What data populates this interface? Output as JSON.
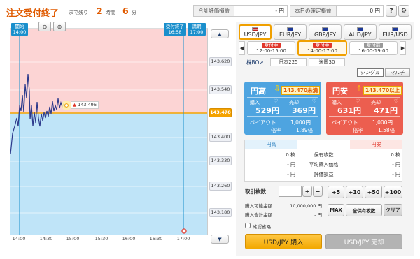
{
  "header": {
    "title": "注文受付終了",
    "remaining_prefix": "まで残り",
    "hours_value": "2",
    "hours_unit": "時間",
    "minutes_value": "6",
    "minutes_unit": "分",
    "total_eval_label": "合計評価損益",
    "total_eval_value": "- 円",
    "settled_label": "本日の確定損益",
    "settled_value": "0 円",
    "help_icon": "question-icon",
    "settings_icon": "gear-icon"
  },
  "chart": {
    "open_tag": [
      "開始",
      "14:00"
    ],
    "close_tag": [
      "受付終了",
      "16:58"
    ],
    "expiry_tag": [
      "満期",
      "17:00"
    ],
    "current_price_label": "143.496",
    "y_ticks": [
      "143.620",
      "143.540",
      "143.470",
      "143.400",
      "143.330",
      "143.260",
      "143.180"
    ],
    "current_y_tick": "143.470",
    "x_ticks": [
      "14:00",
      "14:30",
      "15:00",
      "15:30",
      "16:00",
      "16:30",
      "17:00"
    ],
    "zoom_out_icon": "zoom-out-icon",
    "zoom_in_icon": "zoom-in-icon",
    "scroll_up": "▲",
    "scroll_down": "▼",
    "colors": {
      "upper_zone": "#fcd4d4",
      "lower_zone": "#bfe4f8",
      "line": "#2d3a8c",
      "target": "#f5a300"
    }
  },
  "currency_tabs": [
    {
      "label": "USD/JPY",
      "selected": true
    },
    {
      "label": "EUR/JPY",
      "selected": false
    },
    {
      "label": "GBP/JPY",
      "selected": false
    },
    {
      "label": "AUD/JPY",
      "selected": false
    },
    {
      "label": "EUR/USD",
      "selected": false
    }
  ],
  "sessions": [
    {
      "status": "受付中",
      "time": "12:00-15:00",
      "selected": false,
      "status_color": "#e0362a"
    },
    {
      "status": "受付中",
      "time": "14:00-17:00",
      "selected": true,
      "status_color": "#e0362a"
    },
    {
      "status": "受付前",
      "time": "16:00-19:00",
      "selected": false,
      "status_color": "#999999"
    }
  ],
  "markets": {
    "link": "株BO↗",
    "nikkei": "日本225",
    "us": "米国30"
  },
  "modes": {
    "single": "シングル",
    "multi": "マルチ"
  },
  "high_card": {
    "title": "円高",
    "target": "143.470未満",
    "buy_label": "購入",
    "sell_label": "売却",
    "buy_price": "529円",
    "sell_price": "369円",
    "payout_label": "ペイアウト",
    "payout_value": "1,000円",
    "rate_label": "倍率",
    "rate_value": "1.89倍",
    "color": "#4ea4e0"
  },
  "low_card": {
    "title": "円安",
    "target": "143.470以上",
    "buy_label": "購入",
    "sell_label": "売却",
    "buy_price": "631円",
    "sell_price": "471円",
    "payout_label": "ペイアウト",
    "payout_value": "1,000円",
    "rate_label": "倍率",
    "rate_value": "1.58倍",
    "color": "#ec5e4f"
  },
  "holdings": {
    "high_header": "円高",
    "low_header": "円安",
    "rows": [
      {
        "left": "0 枚",
        "label": "保有枚数",
        "right": "0 枚"
      },
      {
        "left": "- 円",
        "label": "平均購入価格",
        "right": "- 円"
      },
      {
        "left": "- 円",
        "label": "評価損益",
        "right": "- 円"
      }
    ]
  },
  "order": {
    "qty_label": "取引枚数",
    "qty_value": "",
    "plus": "+",
    "minus": "−",
    "available_label": "購入可能金額",
    "available_value": "10,000,000 円",
    "total_label": "購入合計金額",
    "total_value": "- 円",
    "quick": [
      "+5",
      "+10",
      "+50",
      "+100"
    ],
    "max": "MAX",
    "all_holdings": "全保有枚数",
    "clear": "クリア",
    "confirm_skip": "確認省略",
    "buy_button": "USD/JPY 購入",
    "sell_button": "USD/JPY 売却"
  }
}
